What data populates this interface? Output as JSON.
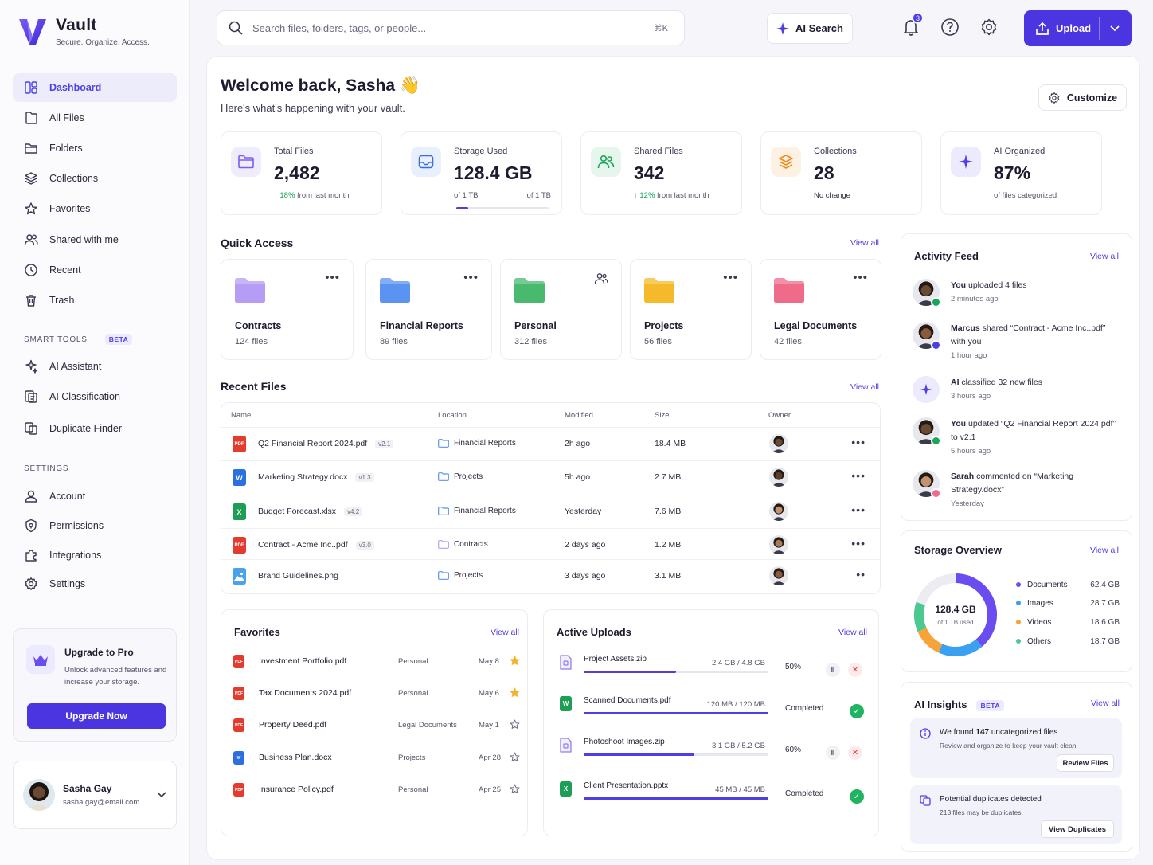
{
  "brand": {
    "name": "Vault",
    "tagline": "Secure. Organize. Access."
  },
  "sidebar": {
    "nav": [
      {
        "label": "Dashboard",
        "icon": "dashboard-icon"
      },
      {
        "label": "All Files",
        "icon": "file-icon"
      },
      {
        "label": "Folders",
        "icon": "folder-icon"
      },
      {
        "label": "Collections",
        "icon": "layers-icon"
      },
      {
        "label": "Favorites",
        "icon": "star-icon"
      },
      {
        "label": "Shared with me",
        "icon": "users-icon"
      },
      {
        "label": "Recent",
        "icon": "clock-icon"
      },
      {
        "label": "Trash",
        "icon": "trash-icon"
      }
    ],
    "smart_tools_label": "SMART TOOLS",
    "beta_label": "BETA",
    "smart_tools": [
      {
        "label": "AI Assistant",
        "icon": "sparkle-icon"
      },
      {
        "label": "AI Classification",
        "icon": "classify-icon"
      },
      {
        "label": "Duplicate Finder",
        "icon": "duplicate-icon"
      }
    ],
    "settings_label": "SETTINGS",
    "settings": [
      {
        "label": "Account",
        "icon": "user-icon"
      },
      {
        "label": "Permissions",
        "icon": "lock-icon"
      },
      {
        "label": "Integrations",
        "icon": "puzzle-icon"
      },
      {
        "label": "Settings",
        "icon": "gear-icon"
      }
    ],
    "upgrade": {
      "title": "Upgrade to Pro",
      "text": "Unlock advanced features and increase your storage.",
      "button": "Upgrade Now"
    },
    "user": {
      "name": "Sasha Gay",
      "email": "sasha.gay@email.com"
    }
  },
  "topbar": {
    "search_placeholder": "Search files, folders, tags, or people...",
    "shortcut": "⌘K",
    "ai_search": "AI Search",
    "notifications_count": "3",
    "upload": "Upload"
  },
  "header": {
    "welcome": "Welcome back, Sasha",
    "emoji": "👋",
    "subtitle": "Here's what's happening with your vault.",
    "customize": "Customize"
  },
  "stats": [
    {
      "label": "Total Files",
      "value": "2,482",
      "trend": "18%",
      "trend_text": "from last month",
      "color": "#7c5cf0",
      "bg": "#efecfd"
    },
    {
      "label": "Storage Used",
      "value": "128.4 GB",
      "sub_left": "of 1 TB",
      "sub_right": "of 1 TB",
      "progress": 0.13,
      "color": "#3a6fe0",
      "bg": "#e8f0fd"
    },
    {
      "label": "Shared Files",
      "value": "342",
      "trend": "12%",
      "trend_text": "from last month",
      "color": "#19a55a",
      "bg": "#e6f6ec"
    },
    {
      "label": "Collections",
      "value": "28",
      "sub": "No change",
      "color": "#f08a1c",
      "bg": "#fdf1e3"
    },
    {
      "label": "AI Organized",
      "value": "87%",
      "sub": "of files categorized",
      "color": "#4f3ee6",
      "bg": "#ecebfd"
    }
  ],
  "quick_access": {
    "title": "Quick Access",
    "view_all": "View all",
    "folders": [
      {
        "name": "Contracts",
        "count": "124 files",
        "color": "#b59cf5",
        "menu": "more"
      },
      {
        "name": "Financial Reports",
        "count": "89 files",
        "color": "#5b93f0",
        "menu": "more"
      },
      {
        "name": "Personal",
        "count": "312 files",
        "color": "#48b96d",
        "menu": "shared"
      },
      {
        "name": "Projects",
        "count": "56 files",
        "color": "#f6b92a",
        "menu": "more"
      },
      {
        "name": "Legal Documents",
        "count": "42 files",
        "color": "#f06a8a",
        "menu": "more"
      }
    ]
  },
  "recent_files": {
    "title": "Recent Files",
    "view_all": "View all",
    "columns": [
      "Name",
      "Location",
      "Modified",
      "Size",
      "Owner"
    ],
    "rows": [
      {
        "name": "Q2 Financial Report 2024.pdf",
        "version": "v2.1",
        "type": "pdf",
        "location": "Financial Reports",
        "loc_color": "#5b93f0",
        "modified": "2h ago",
        "size": "18.4 MB",
        "owner_skin": "#6b4a34"
      },
      {
        "name": "Marketing Strategy.docx",
        "version": "v1.3",
        "type": "doc",
        "location": "Projects",
        "loc_color": "#5b93f0",
        "modified": "5h ago",
        "size": "2.7 MB",
        "owner_skin": "#5a3d2b"
      },
      {
        "name": "Budget Forecast.xlsx",
        "version": "v4.2",
        "type": "xls",
        "location": "Financial Reports",
        "loc_color": "#5b93f0",
        "modified": "Yesterday",
        "size": "7.6 MB",
        "owner_skin": "#c49270"
      },
      {
        "name": "Contract - Acme Inc..pdf",
        "version": "v3.0",
        "type": "pdf",
        "location": "Contracts",
        "loc_color": "#b59cf5",
        "modified": "2 days ago",
        "size": "1.2 MB",
        "owner_skin": "#a87a5a"
      },
      {
        "name": "Brand Guidelines.png",
        "version": "",
        "type": "img",
        "location": "Projects",
        "loc_color": "#5b93f0",
        "modified": "3 days ago",
        "size": "3.1 MB",
        "owner_skin": "#8a5a3c"
      }
    ]
  },
  "favorites": {
    "title": "Favorites",
    "view_all": "View all",
    "items": [
      {
        "name": "Investment Portfolio.pdf",
        "type": "pdf",
        "location": "Personal",
        "date": "May 8",
        "starred": true
      },
      {
        "name": "Tax Documents 2024.pdf",
        "type": "pdf",
        "location": "Personal",
        "date": "May 6",
        "starred": true
      },
      {
        "name": "Property Deed.pdf",
        "type": "pdf",
        "location": "Legal Documents",
        "date": "May 1",
        "starred": false
      },
      {
        "name": "Business Plan.docx",
        "type": "doc",
        "location": "Projects",
        "date": "Apr 28",
        "starred": false
      },
      {
        "name": "Insurance Policy.pdf",
        "type": "pdf",
        "location": "Personal",
        "date": "Apr 25",
        "starred": false
      }
    ]
  },
  "uploads": {
    "title": "Active Uploads",
    "view_all": "View all",
    "items": [
      {
        "name": "Project Assets.zip",
        "size": "2.4 GB / 4.8 GB",
        "progress": 0.5,
        "status": "50%",
        "done": false,
        "icon_color": "#8f7ef0"
      },
      {
        "name": "Scanned Documents.pdf",
        "size": "120 MB / 120 MB",
        "progress": 1.0,
        "status": "Completed",
        "done": true,
        "icon_color": "#1e9e54"
      },
      {
        "name": "Photoshoot Images.zip",
        "size": "3.1 GB / 5.2 GB",
        "progress": 0.6,
        "status": "60%",
        "done": false,
        "icon_color": "#8f7ef0"
      },
      {
        "name": "Client Presentation.pptx",
        "size": "45 MB / 45 MB",
        "progress": 1.0,
        "status": "Completed",
        "done": true,
        "icon_color": "#1e9e54"
      }
    ]
  },
  "activity": {
    "title": "Activity Feed",
    "view_all": "View all",
    "items": [
      {
        "actor": "You",
        "text": " uploaded 4 files",
        "time": "2 minutes ago",
        "skin": "#6b4a34",
        "badge": "#19a55a"
      },
      {
        "actor": "Marcus",
        "text": " shared “Contract - Acme Inc..pdf” with you",
        "time": "1 hour ago",
        "skin": "#8a5a3c",
        "badge": "#4f3ee6"
      },
      {
        "actor": "AI",
        "text": " classified 32 new files",
        "time": "3 hours ago",
        "skin": "",
        "badge": ""
      },
      {
        "actor": "You",
        "text": " updated “Q2 Financial Report 2024.pdf” to v2.1",
        "time": "5 hours ago",
        "skin": "#6b4a34",
        "badge": "#19a55a"
      },
      {
        "actor": "Sarah",
        "text": " commented on “Marketing Strategy.docx”",
        "time": "Yesterday",
        "skin": "#c49270",
        "badge": "#f06a8a"
      }
    ]
  },
  "storage": {
    "title": "Storage Overview",
    "view_all": "View all",
    "total": "128.4 GB",
    "total_sub": "of 1 TB used",
    "segments": [
      {
        "label": "Documents",
        "value": "62.4 GB",
        "gb": 62.4,
        "color": "#6a4cf0"
      },
      {
        "label": "Images",
        "value": "28.7 GB",
        "gb": 28.7,
        "color": "#3aa0f0"
      },
      {
        "label": "Videos",
        "value": "18.6 GB",
        "gb": 18.6,
        "color": "#f6a43a"
      },
      {
        "label": "Others",
        "value": "18.7 GB",
        "gb": 18.7,
        "color": "#4cc992"
      }
    ]
  },
  "insights": {
    "title": "AI Insights",
    "beta": "BETA",
    "view_all": "View all",
    "items": [
      {
        "title_pre": "We found ",
        "title_bold": "147",
        "title_post": " uncategorized files",
        "text": "Review and organize to keep your vault clean.",
        "button": "Review Files"
      },
      {
        "title_pre": "Potential duplicates detected",
        "title_bold": "",
        "title_post": "",
        "text": "213 files may be duplicates.",
        "button": "View Duplicates"
      }
    ]
  }
}
